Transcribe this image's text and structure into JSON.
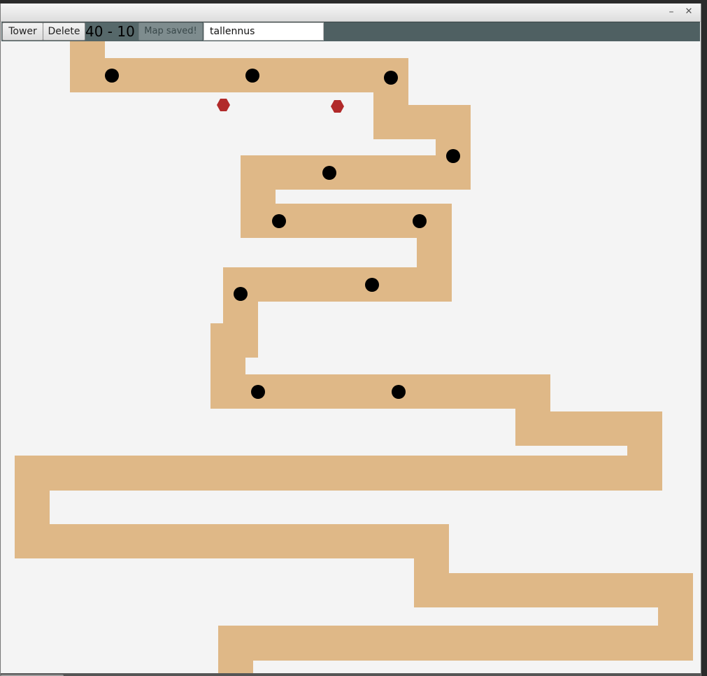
{
  "window": {
    "minimize_symbol": "–",
    "close_symbol": "✕"
  },
  "toolbar": {
    "tower_label": "Tower",
    "delete_label": "Delete",
    "score_text": "40 - 10",
    "status_label": "Map saved!",
    "map_name_value": "tallennus"
  },
  "colors": {
    "path": "#dfb887",
    "canvas_background": "#f4f4f4",
    "tower": "#000000",
    "enemy": "#b12a2a",
    "toolbar_background": "#4f6062"
  },
  "icons": {
    "tower": "black-circle",
    "enemy": "red-hexagon"
  }
}
